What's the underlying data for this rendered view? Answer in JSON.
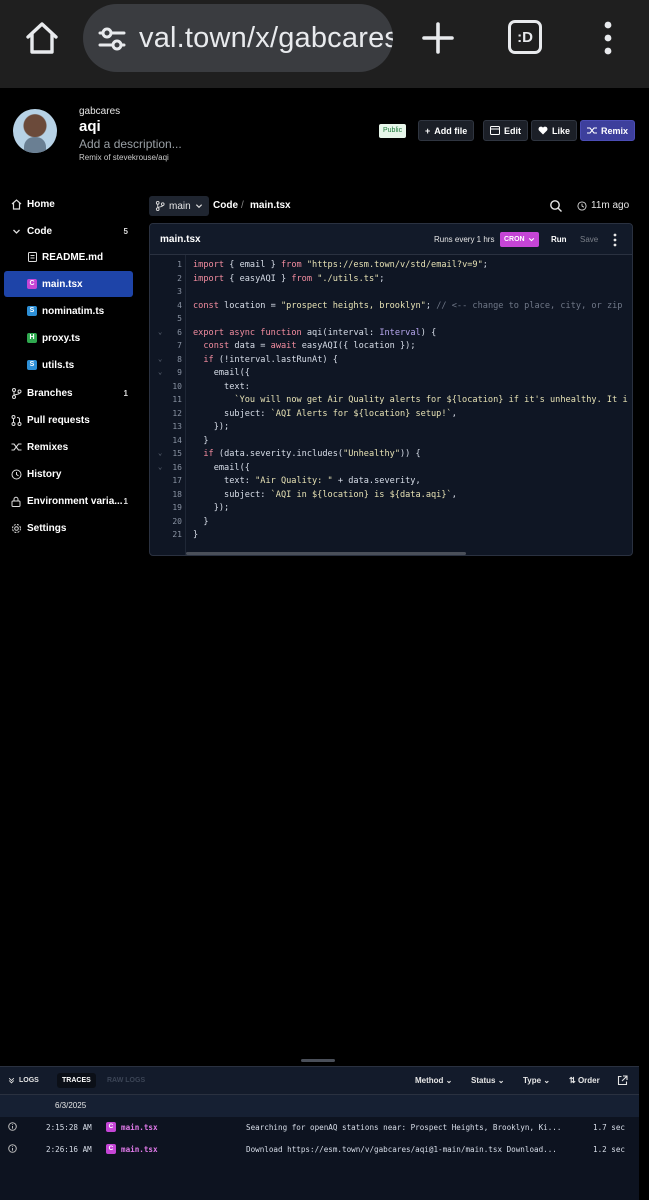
{
  "browser": {
    "url": "val.town/x/gabcares",
    "tab_count": ":D"
  },
  "header": {
    "owner": "gabcares",
    "name": "aqi",
    "description_placeholder": "Add a description...",
    "remix_of": "Remix of stevekrouse/aqi",
    "visibility_badge": "Public",
    "add_file_label": "Add file",
    "edit_label": "Edit",
    "like_label": "Like",
    "remix_label": "Remix"
  },
  "sidebar": {
    "home": "Home",
    "code": "Code",
    "code_count": "5",
    "files": [
      {
        "name": "README.md",
        "type": "doc"
      },
      {
        "name": "main.tsx",
        "type": "C",
        "color": "#c545d6"
      },
      {
        "name": "nominatim.ts",
        "type": "S",
        "color": "#2d8fd6"
      },
      {
        "name": "proxy.ts",
        "type": "H",
        "color": "#2fa84f"
      },
      {
        "name": "utils.ts",
        "type": "S",
        "color": "#2d8fd6"
      }
    ],
    "branches": "Branches",
    "branches_count": "1",
    "pull_requests": "Pull requests",
    "remixes": "Remixes",
    "history": "History",
    "environment": "Environment varia...",
    "environment_count": "1",
    "settings": "Settings"
  },
  "toolbar": {
    "branch": "main",
    "crumb_code": "Code",
    "crumb_sep": "/",
    "crumb_file": "main.tsx",
    "updated": "11m ago"
  },
  "editor": {
    "file_title": "main.tsx",
    "runs_every": "Runs every 1 hrs",
    "cron_label": "CRON",
    "run_label": "Run",
    "save_label": "Save"
  },
  "code_lines": [
    {
      "n": "1",
      "fold": "",
      "html": "<span class='tk-kw'>import</span> { email } <span class='tk-kw'>from</span> <span class='tk-str'>\"https://esm.town/v/std/email?v=9\"</span>;"
    },
    {
      "n": "2",
      "fold": "",
      "html": "<span class='tk-kw'>import</span> { easyAQI } <span class='tk-kw'>from</span> <span class='tk-str'>\"./utils.ts\"</span>;"
    },
    {
      "n": "3",
      "fold": "",
      "html": ""
    },
    {
      "n": "4",
      "fold": "",
      "html": "<span class='tk-kw'>const</span> location = <span class='tk-str'>\"prospect heights, brooklyn\"</span>; <span class='tk-cm'>// &lt;-- change to place, city, or zip</span>"
    },
    {
      "n": "5",
      "fold": "",
      "html": ""
    },
    {
      "n": "6",
      "fold": "⌄",
      "html": "<span class='tk-kw'>export</span> <span class='tk-kw'>async</span> <span class='tk-kw'>function</span> aqi(interval: <span class='tk-ty'>Interval</span>) {"
    },
    {
      "n": "7",
      "fold": "",
      "html": "  <span class='tk-kw'>const</span> data = <span class='tk-kw'>await</span> easyAQI({ location });"
    },
    {
      "n": "8",
      "fold": "⌄",
      "html": "  <span class='tk-kw'>if</span> (!interval.lastRunAt) {"
    },
    {
      "n": "9",
      "fold": "⌄",
      "html": "    email({"
    },
    {
      "n": "10",
      "fold": "",
      "html": "      text:"
    },
    {
      "n": "11",
      "fold": "",
      "html": "        <span class='tk-str'>`You will now get Air Quality alerts for ${location} if it's unhealthy. It i</span>"
    },
    {
      "n": "12",
      "fold": "",
      "html": "      subject: <span class='tk-str'>`AQI Alerts for ${location} setup!`</span>,"
    },
    {
      "n": "13",
      "fold": "",
      "html": "    });"
    },
    {
      "n": "14",
      "fold": "",
      "html": "  }"
    },
    {
      "n": "15",
      "fold": "⌄",
      "html": "  <span class='tk-kw'>if</span> (data.severity.includes(<span class='tk-str'>\"Unhealthy\"</span>)) {"
    },
    {
      "n": "16",
      "fold": "⌄",
      "html": "    email({"
    },
    {
      "n": "17",
      "fold": "",
      "html": "      text: <span class='tk-str'>\"Air Quality: \"</span> + data.severity,"
    },
    {
      "n": "18",
      "fold": "",
      "html": "      subject: <span class='tk-str'>`AQI in ${location} is ${data.aqi}`</span>,"
    },
    {
      "n": "19",
      "fold": "",
      "html": "    });"
    },
    {
      "n": "20",
      "fold": "",
      "html": "  }"
    },
    {
      "n": "21",
      "fold": "",
      "html": "}"
    }
  ],
  "logs": {
    "title": "LOGS",
    "tab_traces": "TRACES",
    "tab_raw": "RAW LOGS",
    "filter_method": "Method",
    "filter_status": "Status",
    "filter_type": "Type",
    "order_label": "Order",
    "date": "6/3/2025",
    "rows": [
      {
        "time": "2:15:28 AM",
        "badge": "C",
        "file": "main.tsx",
        "message": "Searching for openAQ stations near: Prospect Heights, Brooklyn, Ki...",
        "duration": "1.7 sec"
      },
      {
        "time": "2:26:16 AM",
        "badge": "C",
        "file": "main.tsx",
        "message": "Download https://esm.town/v/gabcares/aqi@1-main/main.tsx  Download...",
        "duration": "1.2 sec"
      }
    ]
  },
  "colors": {
    "accent": "#1e44a8",
    "remix": "#3d3f9c",
    "cron": "#c545d6",
    "editor_bg": "#0f1624"
  }
}
